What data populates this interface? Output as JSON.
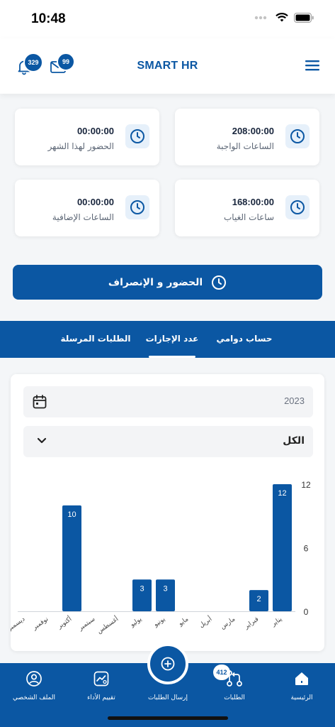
{
  "status_bar": {
    "time": "10:48"
  },
  "header": {
    "title": "SMART HR",
    "notifications_count": "329",
    "messages_count": "99"
  },
  "stats": [
    {
      "value": "208:00:00",
      "label": "الساعات الواجبة"
    },
    {
      "value": "00:00:00",
      "label": "الحضور لهذا الشهر"
    },
    {
      "value": "168:00:00",
      "label": "ساعات الغياب"
    },
    {
      "value": "00:00:00",
      "label": "الساعات الإضافية"
    }
  ],
  "attendance_button": "الحضور و الإنصراف",
  "tabs": [
    {
      "label": "حساب دوامي",
      "active": false
    },
    {
      "label": "عدد الإجازات",
      "active": true
    },
    {
      "label": "الطلبات المرسلة",
      "active": false
    }
  ],
  "year_field": {
    "value": "2023"
  },
  "filter_select": {
    "value": "الكل"
  },
  "chart_data": {
    "type": "bar",
    "categories": [
      "يناير",
      "فبراير",
      "مارس",
      "أبريل",
      "مايو",
      "يونيو",
      "يوليو",
      "أغسطس",
      "سبتمبر",
      "أكتوبر",
      "نوفمبر",
      "ديسمبر"
    ],
    "values": [
      12,
      2,
      0,
      0,
      0,
      3,
      3,
      0,
      0,
      10,
      0,
      0
    ],
    "data_labels": [
      "12",
      "2",
      "",
      "",
      "",
      "3",
      "3",
      "",
      "",
      "10",
      "",
      ""
    ],
    "yticks": [
      "0",
      "6",
      "12"
    ],
    "ylim": [
      0,
      12
    ],
    "bar_color": "#0b57a3",
    "orientation": "right-to-left"
  },
  "bottom_nav": {
    "items": [
      {
        "label": "الرئيسية",
        "icon": "home-icon"
      },
      {
        "label": "الطلبات",
        "icon": "requests-icon",
        "badge": "412"
      },
      {
        "label": "إرسال الطلبات",
        "icon": "plus-icon"
      },
      {
        "label": "تقييم الأداء",
        "icon": "performance-icon"
      },
      {
        "label": "الملف الشخصي",
        "icon": "profile-icon"
      }
    ]
  },
  "colors": {
    "primary": "#0b57a3",
    "background": "#f4f6f8"
  }
}
